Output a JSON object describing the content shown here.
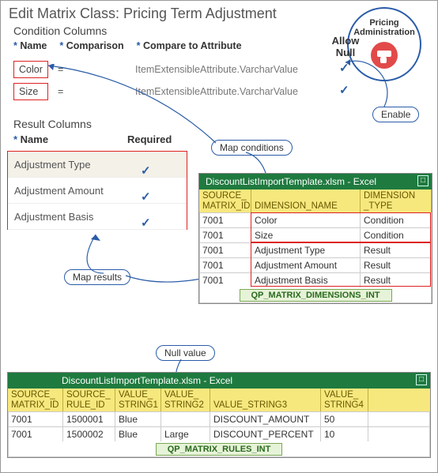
{
  "title": "Edit Matrix Class: Pricing Term Adjustment",
  "badge": {
    "line1": "Pricing",
    "line2": "Administration"
  },
  "condition": {
    "section": "Condition Columns",
    "hdr_name": "Name",
    "hdr_comp": "Comparison",
    "hdr_attr": "Compare to Attribute",
    "allow_null": "Allow Null",
    "rows": [
      {
        "name": "Color",
        "comp": "=",
        "attr": "ItemExtensibleAttribute.VarcharValue"
      },
      {
        "name": "Size",
        "comp": "=",
        "attr": "ItemExtensibleAttribute.VarcharValue"
      }
    ]
  },
  "results": {
    "section": "Result Columns",
    "hdr_name": "Name",
    "hdr_req": "Required",
    "rows": [
      {
        "name": "Adjustment Type"
      },
      {
        "name": "Adjustment Amount"
      },
      {
        "name": "Adjustment Basis"
      }
    ]
  },
  "callouts": {
    "enable": "Enable",
    "map_conditions": "Map conditions",
    "map_results": "Map results",
    "null_value": "Null value"
  },
  "excel_dims": {
    "title": "DiscountListImportTemplate.xlsm - Excel",
    "hdr_source": "SOURCE_",
    "hdr_matrix_id": "MATRIX_ID",
    "hdr_dim_name": "DIMENSION_NAME",
    "hdr_dim": "DIMENSION",
    "hdr_type": "_TYPE",
    "sheet": "QP_MATRIX_DIMENSIONS_INT",
    "rows": [
      {
        "id": "7001",
        "name": "Color",
        "type": "Condition"
      },
      {
        "id": "7001",
        "name": "Size",
        "type": "Condition"
      },
      {
        "id": "7001",
        "name": "Adjustment Type",
        "type": "Result"
      },
      {
        "id": "7001",
        "name": "Adjustment Amount",
        "type": "Result"
      },
      {
        "id": "7001",
        "name": "Adjustment Basis",
        "type": "Result"
      }
    ]
  },
  "excel_rules": {
    "title": "DiscountListImportTemplate.xlsm - Excel",
    "hdr_source": "SOURCE_",
    "hdr_matrix_id": "MATRIX_ID",
    "hdr_rule_id": "RULE_ID",
    "hdr_v": "VALUE_",
    "hdr_s1": "STRING1",
    "hdr_s2": "STRING2",
    "hdr_s3": "VALUE_STRING3",
    "hdr_s4": "STRING4",
    "sheet": "QP_MATRIX_RULES_INT",
    "rows": [
      {
        "id": "7001",
        "rule": "1500001",
        "s1": "Blue",
        "s2": "",
        "s3": "DISCOUNT_AMOUNT",
        "s4": "50"
      },
      {
        "id": "7001",
        "rule": "1500002",
        "s1": "Blue",
        "s2": "Large",
        "s3": "DISCOUNT_PERCENT",
        "s4": "10"
      }
    ]
  },
  "chart_data": {
    "type": "table",
    "views": [
      {
        "name": "QP_MATRIX_DIMENSIONS_INT",
        "columns": [
          "SOURCE_MATRIX_ID",
          "DIMENSION_NAME",
          "DIMENSION_TYPE"
        ],
        "rows": [
          [
            "7001",
            "Color",
            "Condition"
          ],
          [
            "7001",
            "Size",
            "Condition"
          ],
          [
            "7001",
            "Adjustment Type",
            "Result"
          ],
          [
            "7001",
            "Adjustment Amount",
            "Result"
          ],
          [
            "7001",
            "Adjustment Basis",
            "Result"
          ]
        ]
      },
      {
        "name": "QP_MATRIX_RULES_INT",
        "columns": [
          "SOURCE_MATRIX_ID",
          "SOURCE_RULE_ID",
          "VALUE_STRING1",
          "VALUE_STRING2",
          "VALUE_STRING3",
          "VALUE_STRING4"
        ],
        "rows": [
          [
            "7001",
            "1500001",
            "Blue",
            "",
            "DISCOUNT_AMOUNT",
            "50"
          ],
          [
            "7001",
            "1500002",
            "Blue",
            "Large",
            "DISCOUNT_PERCENT",
            "10"
          ]
        ]
      }
    ]
  }
}
